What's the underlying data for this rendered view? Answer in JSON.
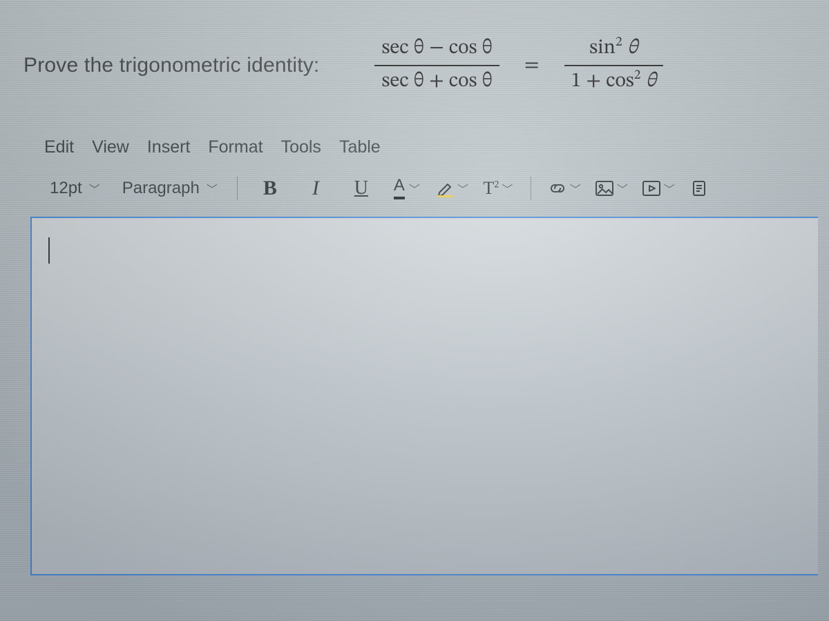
{
  "prompt": "Prove the trigonometric identity:",
  "equation": {
    "left": {
      "num": "sec θ − cos θ",
      "den": "sec θ + cos θ"
    },
    "eq": "=",
    "right": {
      "num_html": "sin² θ",
      "den_html": "1 + cos² θ"
    }
  },
  "menubar": [
    "Edit",
    "View",
    "Insert",
    "Format",
    "Tools",
    "Table"
  ],
  "toolbar": {
    "font_size": "12pt",
    "block_format": "Paragraph",
    "bold": "B",
    "italic": "I",
    "underline": "U",
    "textcolor": "A",
    "superscript_html": "T²"
  },
  "content": ""
}
